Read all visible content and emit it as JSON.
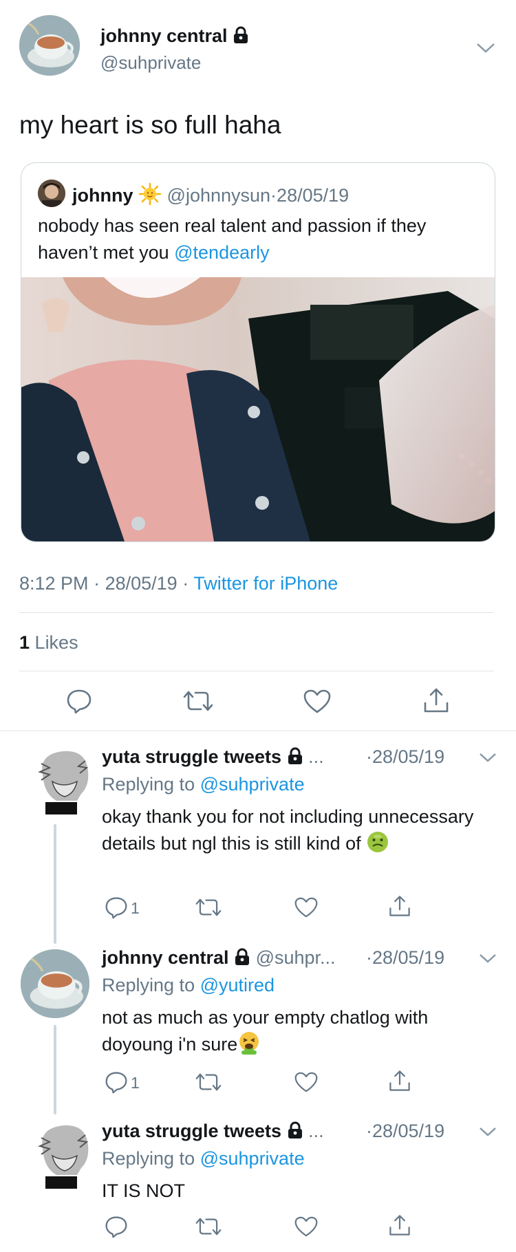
{
  "main_tweet": {
    "display_name": "johnny central",
    "handle": "@suhprivate",
    "text": "my heart is so full haha",
    "time": "8:12 PM",
    "sep1": "·",
    "date": "28/05/19",
    "sep2": "·",
    "source": "Twitter for iPhone",
    "likes_count": "1",
    "likes_label": "Likes"
  },
  "quoted_tweet": {
    "display_name": "johnny",
    "handle": "@johnnysun",
    "sep": "·",
    "date": "28/05/19",
    "text": "nobody has seen real talent and passion if they haven’t met you",
    "mention": "@tendearly"
  },
  "replies": [
    {
      "display_name": "yuta struggle tweets",
      "ellipsis": "...",
      "date": "·28/05/19",
      "replying_label": "Replying to",
      "replying_to": "@suhprivate",
      "text": "okay thank you for not including unnecessary details but ngl this is still kind of",
      "reply_count": "1"
    },
    {
      "display_name": "johnny central",
      "handle": "@suhpr...",
      "date": "·28/05/19",
      "replying_label": "Replying to",
      "replying_to": "@yutired",
      "text": "not as much as your empty chatlog with doyoung i'n sure",
      "reply_count": "1"
    },
    {
      "display_name": "yuta struggle tweets",
      "ellipsis": "...",
      "date": "·28/05/19",
      "replying_label": "Replying to",
      "replying_to": "@suhprivate",
      "text": "IT IS NOT",
      "reply_count": ""
    }
  ],
  "colors": {
    "link": "#1b95e0",
    "secondary": "#657786",
    "border": "#dfe3e7",
    "icon": "#657786"
  }
}
